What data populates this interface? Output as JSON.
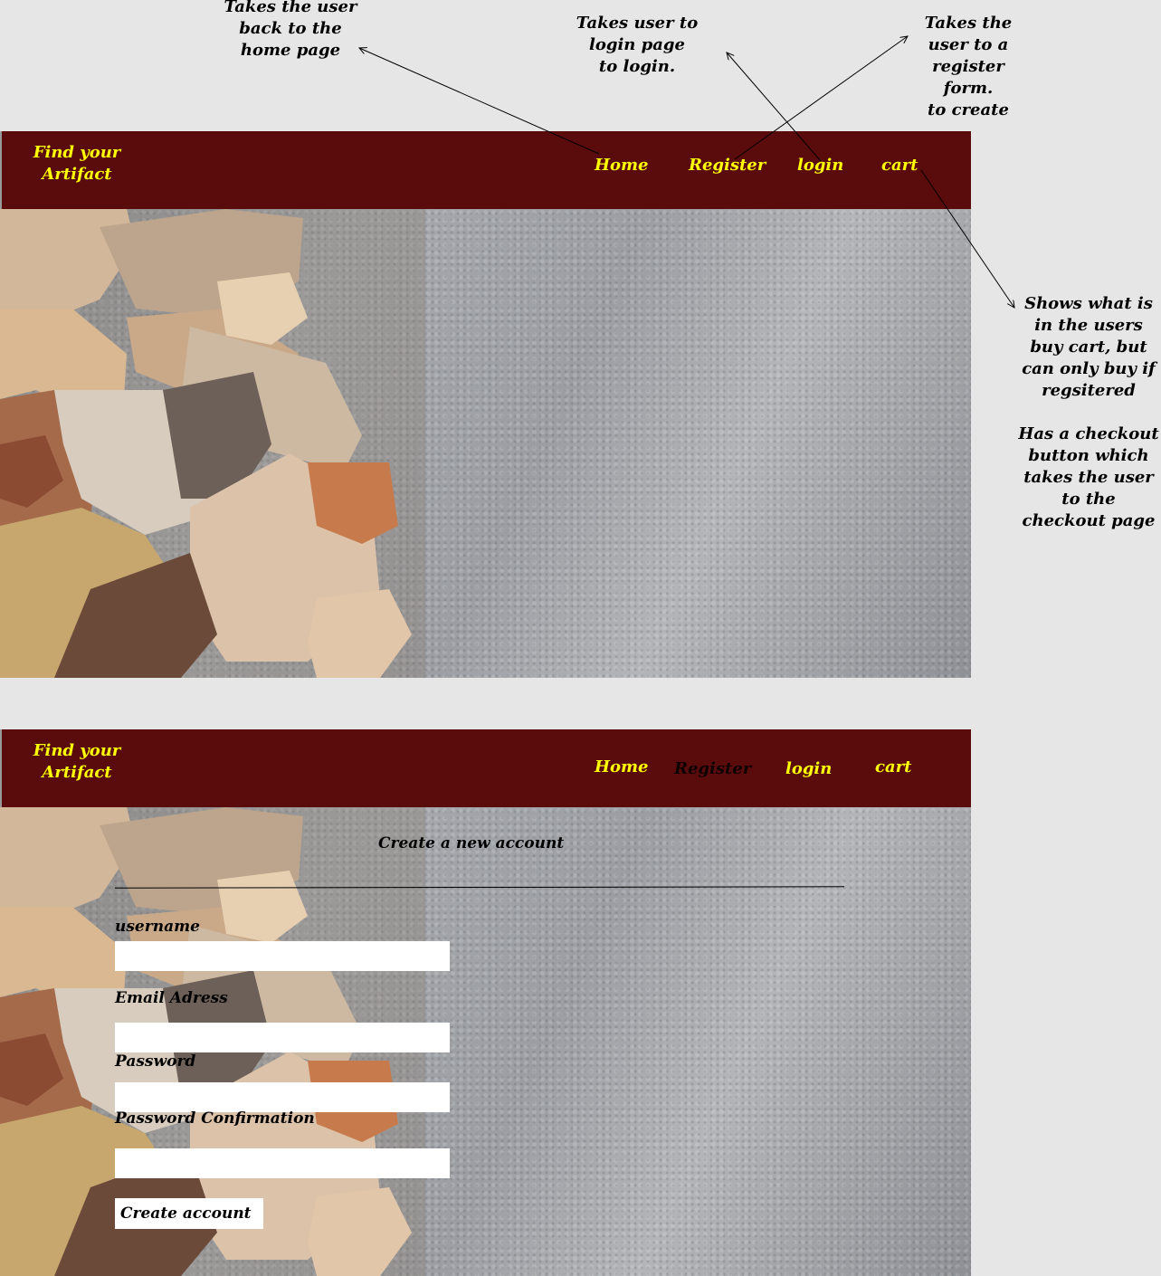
{
  "annotations": {
    "home": "Takes the user\nback to the\nhome page",
    "login": "Takes user to\nlogin page\nto login.",
    "register": "Takes the\nuser to a\nregister\nform.\nto create",
    "cart": "Shows what is\nin the users\nbuy cart, but\ncan only buy if\nregsitered\n\nHas a checkout\nbutton which\ntakes the user\nto the\ncheckout page"
  },
  "mock1": {
    "brand": "Find your\nArtifact",
    "nav": {
      "home": "Home",
      "register": "Register",
      "login": "login",
      "cart": "cart"
    }
  },
  "mock2": {
    "brand": "Find your\nArtifact",
    "nav": {
      "home": "Home",
      "register": "Register",
      "login": "login",
      "cart": "cart"
    },
    "form": {
      "title": "Create a new account",
      "username_label": "username",
      "email_label": "Email Adress",
      "password_label": "Password",
      "password_confirm_label": "Password Confirmation",
      "submit_label": "Create account"
    }
  },
  "colors": {
    "navbar": "#5a0b0c",
    "nav_text": "#ffff00",
    "active_nav_text": "#0d0101",
    "page_background": "#e6e6e6"
  }
}
